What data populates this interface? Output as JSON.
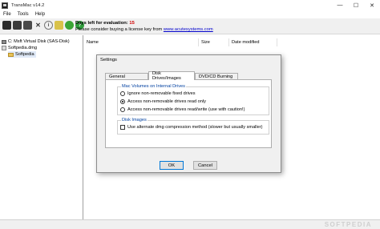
{
  "window": {
    "title": "TransMac v14.2",
    "minimize_glyph": "—",
    "maximize_glyph": "☐",
    "close_glyph": "✕"
  },
  "menu": [
    "File",
    "Tools",
    "Help"
  ],
  "toolbar": {
    "icons": [
      "open-disk-icon",
      "save-icon",
      "format-icon",
      "delete-icon",
      "info-icon",
      "settings-icon",
      "refresh-icon",
      "help-icon"
    ],
    "eval_prefix": "Days left for evaluation:",
    "eval_days": "15",
    "license_text": "Please consider buying a license key from",
    "license_link": "www.acutesystems.com"
  },
  "tree": {
    "items": [
      {
        "label": "C: Msft Virtual Disk (SAS-Disk)",
        "icon": "drive-icon"
      },
      {
        "label": "Softpedia.dmg",
        "icon": "dmg-file-icon"
      },
      {
        "label": "Softpedia",
        "icon": "folder-icon"
      }
    ]
  },
  "filelist": {
    "columns": [
      "Name",
      "Size",
      "Date modified"
    ]
  },
  "statusbar": {
    "watermark": "SOFTPEDIA"
  },
  "dialog": {
    "title": "Settings",
    "tabs": [
      "General",
      "Disk Drives/Images",
      "DVD/CD Burning"
    ],
    "active_tab": "Disk Drives/Images",
    "mac_volumes": {
      "label": "Mac Volumes on Internal Drives",
      "options": [
        "Ignore non-removable fixed drives",
        "Access non-removable drives read only",
        "Access non-removable drives read/write (use with caution!)"
      ],
      "selected": 1
    },
    "disk_images": {
      "label": "Disk Images",
      "checkbox_label": "Use alternate dmg compression method (slower but usually smaller)",
      "checked": false
    },
    "ok_label": "OK",
    "cancel_label": "Cancel"
  },
  "colors": {
    "eval_days": "#d00000",
    "link": "#0000cc",
    "group_label": "#0040a0",
    "accent": "#0078d7"
  }
}
